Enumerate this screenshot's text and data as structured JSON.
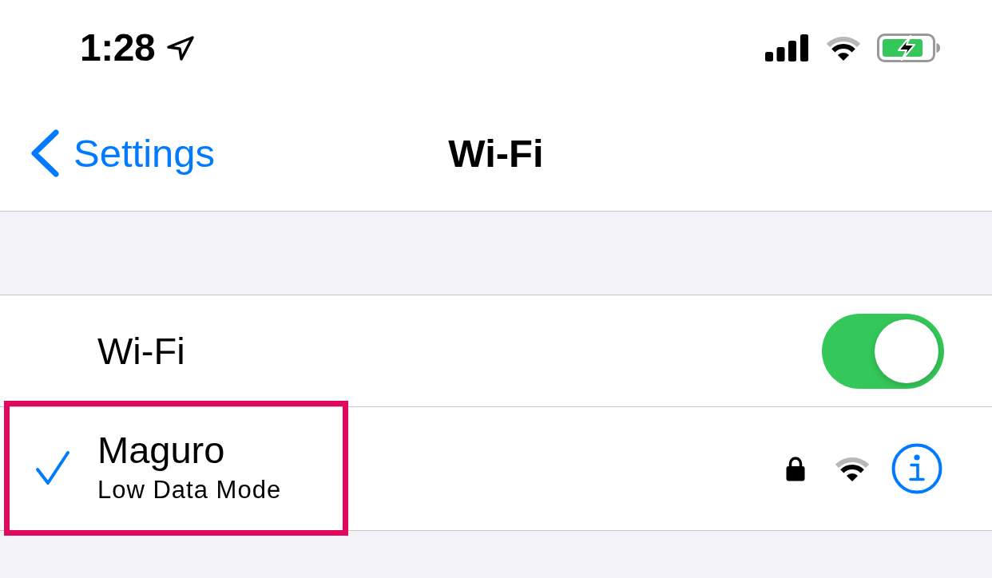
{
  "status_bar": {
    "time": "1:28",
    "charging": true
  },
  "nav": {
    "back_label": "Settings",
    "title": "Wi-Fi"
  },
  "wifi_toggle": {
    "label": "Wi-Fi",
    "on": true
  },
  "networks": [
    {
      "name": "Maguro",
      "subtitle": "Low Data Mode",
      "selected": true,
      "secured": true,
      "highlighted": true
    }
  ]
}
